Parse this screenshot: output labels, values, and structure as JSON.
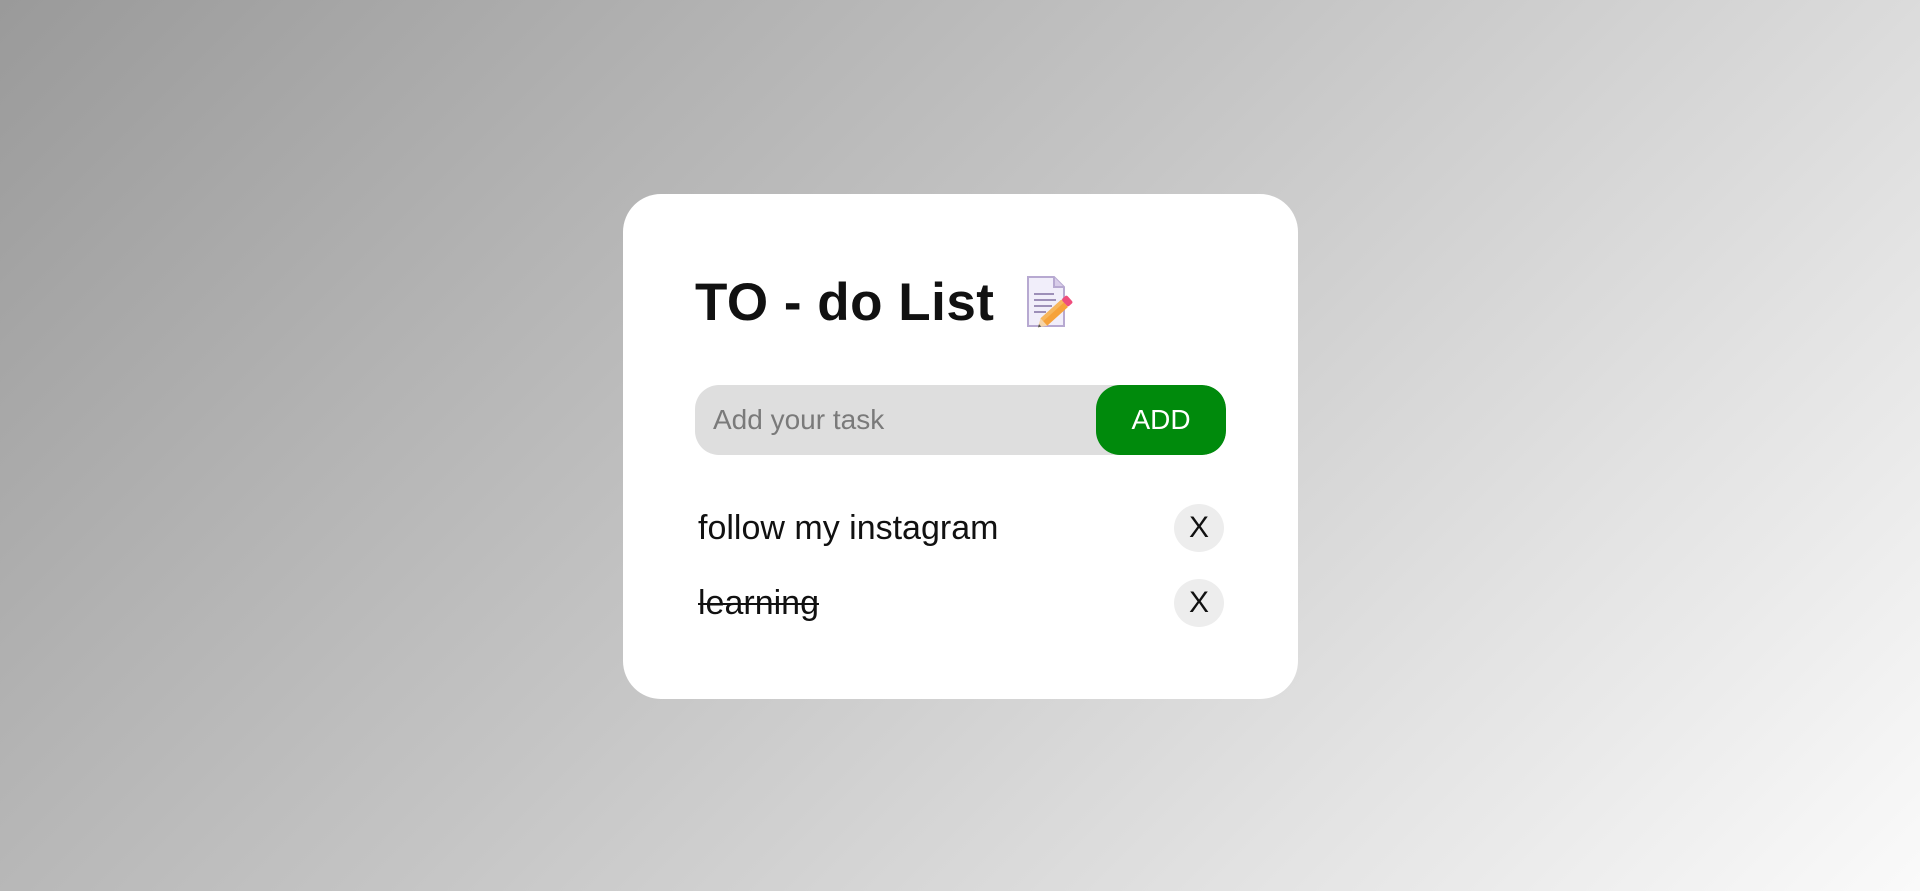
{
  "card": {
    "title": "TO - do List",
    "title_icon": "memo-pencil-icon"
  },
  "input": {
    "placeholder": "Add your task",
    "value": "",
    "add_label": "ADD",
    "add_color": "#008a0c"
  },
  "tasks": [
    {
      "text": "follow my instagram",
      "checked": false,
      "delete_label": "X"
    },
    {
      "text": "learning",
      "checked": true,
      "delete_label": "X"
    }
  ]
}
